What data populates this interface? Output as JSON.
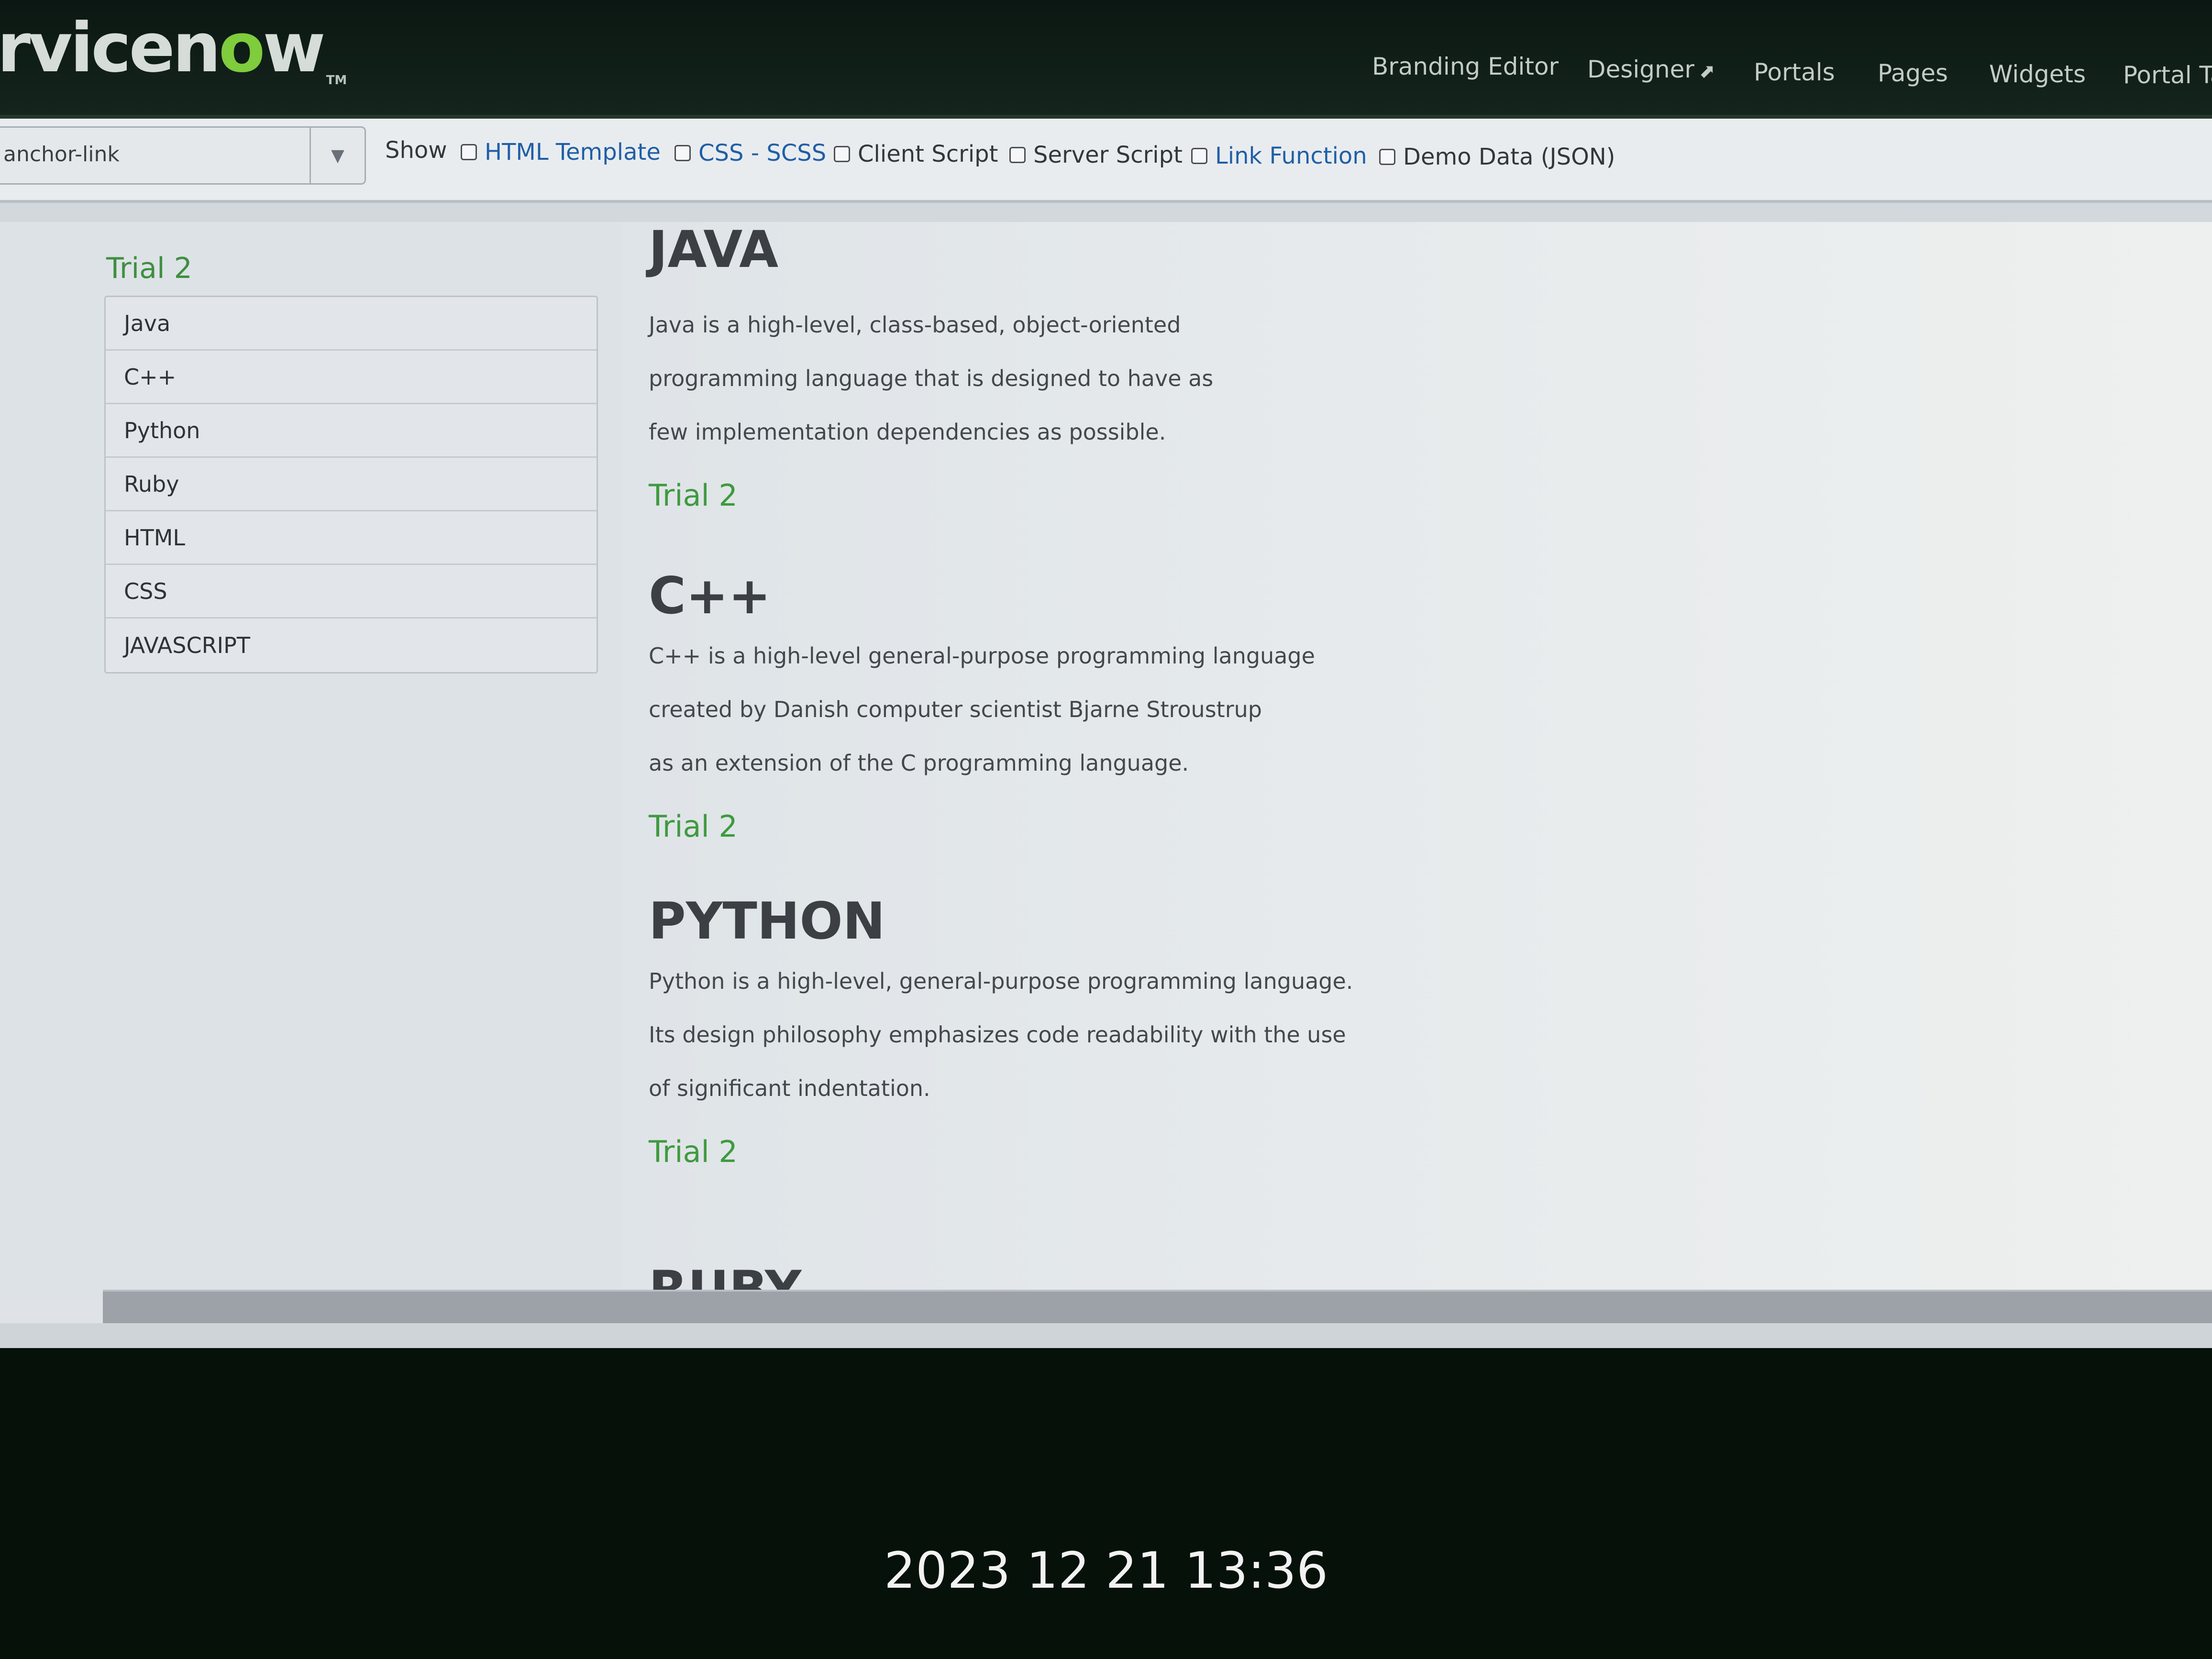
{
  "header": {
    "logo_text": "rvicenow",
    "logo_accent": "o",
    "logo_tail": "w",
    "logo_tm": "TM",
    "nav": [
      {
        "label": "Branding Editor"
      },
      {
        "label": "Designer",
        "icon": "external-link-icon"
      },
      {
        "label": "Portals"
      },
      {
        "label": "Pages"
      },
      {
        "label": "Widgets"
      },
      {
        "label": "Portal Ta"
      }
    ]
  },
  "toolbar": {
    "widget_select_value": "anchor-link",
    "show_label": "Show",
    "checkboxes": [
      {
        "label": "HTML Template",
        "checked": false
      },
      {
        "label": "CSS - SCSS",
        "checked": false
      },
      {
        "label": "Client Script",
        "checked": false
      },
      {
        "label": "Server Script",
        "checked": false
      },
      {
        "label": "Link Function",
        "checked": false
      },
      {
        "label": "Demo Data (JSON)",
        "checked": false
      }
    ]
  },
  "sidebar": {
    "title": "Trial 2",
    "items": [
      {
        "label": "Java"
      },
      {
        "label": "C++"
      },
      {
        "label": "Python"
      },
      {
        "label": "Ruby"
      },
      {
        "label": "HTML"
      },
      {
        "label": "CSS"
      },
      {
        "label": "JAVASCRIPT"
      }
    ]
  },
  "sections": [
    {
      "heading": "JAVA",
      "lines": [
        "Java is a high-level, class-based, object-oriented",
        "programming language that is designed to have as",
        "few implementation dependencies as possible."
      ],
      "link": "Trial 2"
    },
    {
      "heading": "C++",
      "lines": [
        "C++ is a high-level general-purpose programming language",
        "created by Danish computer scientist Bjarne Stroustrup",
        "as an extension of the C programming language."
      ],
      "link": "Trial 2"
    },
    {
      "heading": "PYTHON",
      "lines": [
        "Python is a high-level, general-purpose programming language.",
        "Its design philosophy emphasizes code readability with the use",
        "of significant indentation."
      ],
      "link": "Trial 2"
    },
    {
      "heading": "RUBY"
    }
  ],
  "photo_timestamp": "2023 12 21 13:36",
  "colors": {
    "brand_green": "#7fcc3d",
    "link_green": "#3f9a3f",
    "checkbox_blue": "#1f5fa6"
  }
}
